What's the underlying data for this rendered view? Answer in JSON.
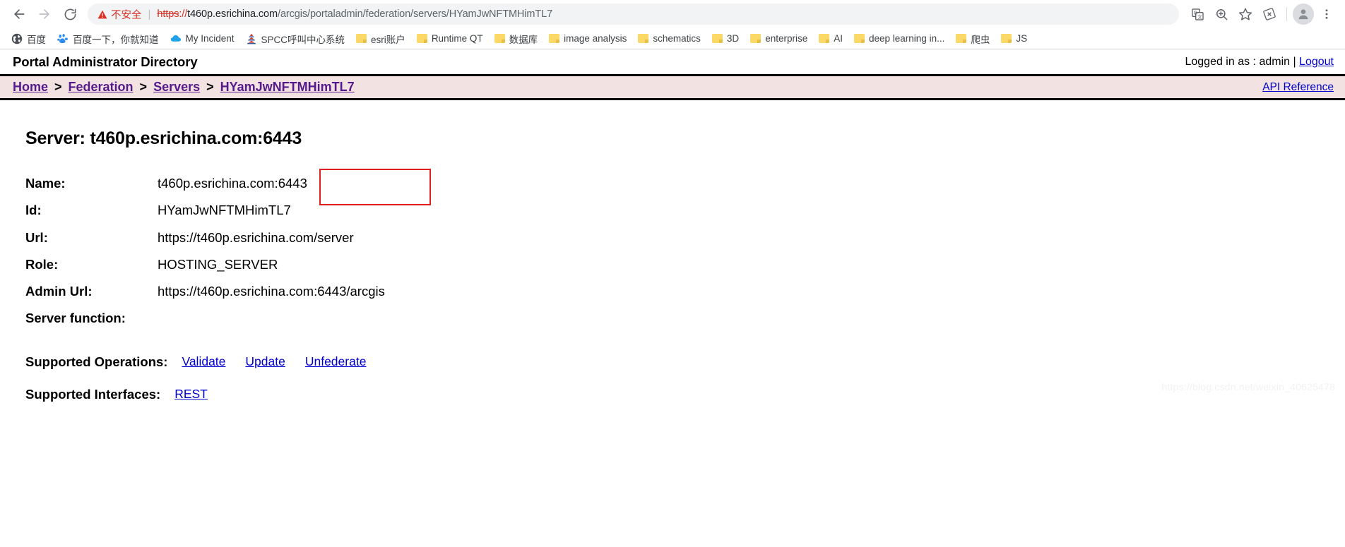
{
  "browser": {
    "nav": {
      "back_title": "Back",
      "forward_title": "Forward",
      "reload_title": "Reload"
    },
    "omnibox": {
      "security_label": "不安全",
      "separator": "|",
      "url_scheme": "https",
      "url_sep": "://",
      "url_host": "t460p.esrichina.com",
      "url_path": "/arcgis/portaladmin/federation/servers/HYamJwNFTMHimTL7",
      "full_url": "https://t460p.esrichina.com/arcgis/portaladmin/federation/servers/HYamJwNFTMHimTL7"
    },
    "toolbar_icons": [
      {
        "name": "translate-icon"
      },
      {
        "name": "zoom-search-icon"
      },
      {
        "name": "bookmark-star-icon"
      },
      {
        "name": "extension-icon"
      },
      {
        "name": "profile-avatar-icon"
      },
      {
        "name": "three-dot-menu-icon"
      }
    ],
    "bookmarks": [
      {
        "label": "百度",
        "icon": "globe-icon"
      },
      {
        "label": "百度一下，你就知道",
        "icon": "baidu-paw-icon"
      },
      {
        "label": "My Incident",
        "icon": "cloud-icon"
      },
      {
        "label": "SPCC呼叫中心系统",
        "icon": "pagoda-icon"
      },
      {
        "label": "esri账户",
        "icon": "folder-icon"
      },
      {
        "label": "Runtime QT",
        "icon": "folder-icon"
      },
      {
        "label": "数据库",
        "icon": "folder-icon"
      },
      {
        "label": "image analysis",
        "icon": "folder-icon"
      },
      {
        "label": "schematics",
        "icon": "folder-icon"
      },
      {
        "label": "3D",
        "icon": "folder-icon"
      },
      {
        "label": "enterprise",
        "icon": "folder-icon"
      },
      {
        "label": "AI",
        "icon": "folder-icon"
      },
      {
        "label": "deep learning in...",
        "icon": "folder-icon"
      },
      {
        "label": "爬虫",
        "icon": "folder-icon"
      },
      {
        "label": "JS",
        "icon": "folder-icon"
      }
    ]
  },
  "portal": {
    "title": "Portal Administrator Directory",
    "logged_in_prefix": "Logged in as : admin",
    "logged_in_sep": "|",
    "logout_label": "Logout",
    "api_reference_label": "API Reference",
    "breadcrumbs": [
      {
        "label": "Home"
      },
      {
        "label": "Federation"
      },
      {
        "label": "Servers"
      },
      {
        "label": "HYamJwNFTMHimTL7"
      }
    ],
    "breadcrumb_separator": ">"
  },
  "main": {
    "heading": "Server: t460p.esrichina.com:6443",
    "properties": [
      {
        "label": "Name:",
        "value": "t460p.esrichina.com:6443"
      },
      {
        "label": "Id:",
        "value": "HYamJwNFTMHimTL7"
      },
      {
        "label": "Url:",
        "value": "https://t460p.esrichina.com/server"
      },
      {
        "label": "Role:",
        "value": "HOSTING_SERVER"
      },
      {
        "label": "Admin Url:",
        "value": "https://t460p.esrichina.com:6443/arcgis"
      },
      {
        "label": "Server function:",
        "value": ""
      }
    ],
    "supported_operations": {
      "label": "Supported Operations:",
      "links": [
        {
          "label": "Validate",
          "highlighted": false
        },
        {
          "label": "Update",
          "highlighted": false
        },
        {
          "label": "Unfederate",
          "highlighted": true
        }
      ]
    },
    "supported_interfaces": {
      "label": "Supported Interfaces:",
      "links": [
        {
          "label": "REST"
        }
      ]
    }
  },
  "watermark": {
    "text": "https://blog.csdn.net/weixin_40625478"
  },
  "colors": {
    "insecure_red": "#d93025",
    "visited_link": "#551a8b",
    "link_blue": "#0000cc",
    "breadcrumb_bg": "#f2e2e2",
    "annotation_red": "#e02020"
  }
}
